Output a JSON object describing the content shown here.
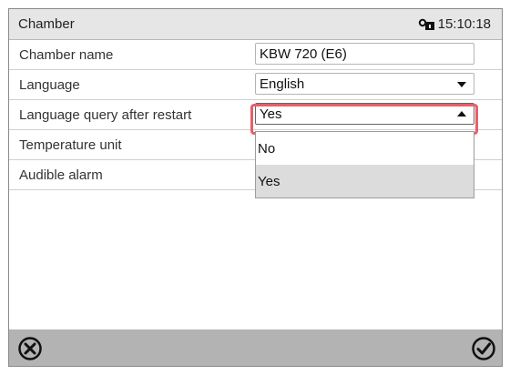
{
  "header": {
    "title": "Chamber",
    "time": "15:10:18"
  },
  "rows": [
    {
      "label": "Chamber name",
      "value": "KBW 720 (E6)"
    },
    {
      "label": "Language",
      "value": "English"
    },
    {
      "label": "Language query after restart",
      "value": "Yes"
    },
    {
      "label": "Temperature unit"
    },
    {
      "label": "Audible alarm"
    }
  ],
  "dropdown": {
    "options": [
      "No",
      "Yes"
    ],
    "selected": "Yes"
  },
  "icons": {
    "header": "lock-icon",
    "cancel": "cancel-icon",
    "confirm": "confirm-icon"
  },
  "colors": {
    "highlight": "#e85f67",
    "footer": "#b3b3b3"
  }
}
